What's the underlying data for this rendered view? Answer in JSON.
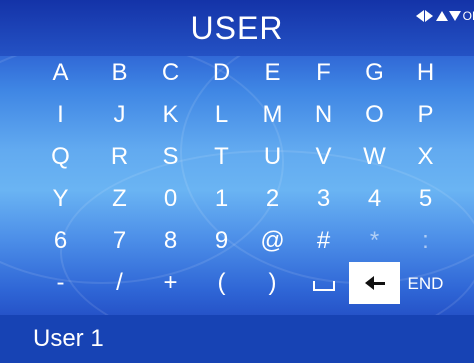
{
  "screen": {
    "title": "USER",
    "nav_hint": {
      "icons": [
        "left-arrow-icon",
        "right-arrow-icon",
        "up-arrow-icon",
        "down-arrow-icon"
      ],
      "ok_label": "OK"
    }
  },
  "keyboard": {
    "rows": [
      [
        "A",
        "B",
        "C",
        "D",
        "E",
        "F",
        "G",
        "H"
      ],
      [
        "I",
        "J",
        "K",
        "L",
        "M",
        "N",
        "O",
        "P"
      ],
      [
        "Q",
        "R",
        "S",
        "T",
        "U",
        "V",
        "W",
        "X"
      ],
      [
        "Y",
        "Z",
        "0",
        "1",
        "2",
        "3",
        "4",
        "5"
      ],
      [
        "6",
        "7",
        "8",
        "9",
        "@",
        "#",
        "*",
        ":"
      ],
      [
        "-",
        "/",
        "+",
        "(",
        ")",
        "space",
        "backspace",
        "END"
      ]
    ],
    "selected_key": "backspace"
  },
  "input": {
    "value": "User 1"
  },
  "colors": {
    "title_bar": "#1433a8",
    "input_bar": "#1743b4",
    "selected_key_bg": "#ffffff",
    "text": "#ffffff"
  }
}
